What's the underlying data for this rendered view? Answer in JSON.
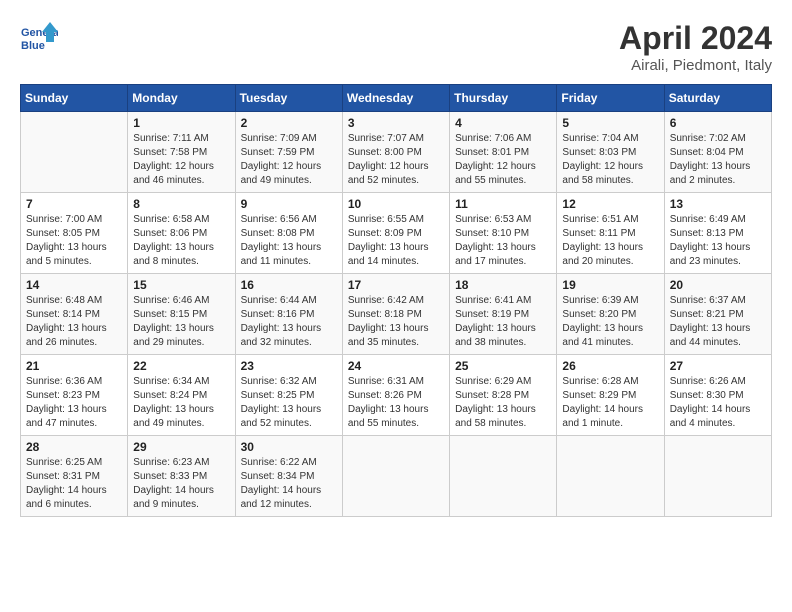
{
  "header": {
    "logo_line1": "General",
    "logo_line2": "Blue",
    "title": "April 2024",
    "subtitle": "Airali, Piedmont, Italy"
  },
  "weekdays": [
    "Sunday",
    "Monday",
    "Tuesday",
    "Wednesday",
    "Thursday",
    "Friday",
    "Saturday"
  ],
  "weeks": [
    [
      {
        "day": "",
        "sunrise": "",
        "sunset": "",
        "daylight": ""
      },
      {
        "day": "1",
        "sunrise": "Sunrise: 7:11 AM",
        "sunset": "Sunset: 7:58 PM",
        "daylight": "Daylight: 12 hours and 46 minutes."
      },
      {
        "day": "2",
        "sunrise": "Sunrise: 7:09 AM",
        "sunset": "Sunset: 7:59 PM",
        "daylight": "Daylight: 12 hours and 49 minutes."
      },
      {
        "day": "3",
        "sunrise": "Sunrise: 7:07 AM",
        "sunset": "Sunset: 8:00 PM",
        "daylight": "Daylight: 12 hours and 52 minutes."
      },
      {
        "day": "4",
        "sunrise": "Sunrise: 7:06 AM",
        "sunset": "Sunset: 8:01 PM",
        "daylight": "Daylight: 12 hours and 55 minutes."
      },
      {
        "day": "5",
        "sunrise": "Sunrise: 7:04 AM",
        "sunset": "Sunset: 8:03 PM",
        "daylight": "Daylight: 12 hours and 58 minutes."
      },
      {
        "day": "6",
        "sunrise": "Sunrise: 7:02 AM",
        "sunset": "Sunset: 8:04 PM",
        "daylight": "Daylight: 13 hours and 2 minutes."
      }
    ],
    [
      {
        "day": "7",
        "sunrise": "Sunrise: 7:00 AM",
        "sunset": "Sunset: 8:05 PM",
        "daylight": "Daylight: 13 hours and 5 minutes."
      },
      {
        "day": "8",
        "sunrise": "Sunrise: 6:58 AM",
        "sunset": "Sunset: 8:06 PM",
        "daylight": "Daylight: 13 hours and 8 minutes."
      },
      {
        "day": "9",
        "sunrise": "Sunrise: 6:56 AM",
        "sunset": "Sunset: 8:08 PM",
        "daylight": "Daylight: 13 hours and 11 minutes."
      },
      {
        "day": "10",
        "sunrise": "Sunrise: 6:55 AM",
        "sunset": "Sunset: 8:09 PM",
        "daylight": "Daylight: 13 hours and 14 minutes."
      },
      {
        "day": "11",
        "sunrise": "Sunrise: 6:53 AM",
        "sunset": "Sunset: 8:10 PM",
        "daylight": "Daylight: 13 hours and 17 minutes."
      },
      {
        "day": "12",
        "sunrise": "Sunrise: 6:51 AM",
        "sunset": "Sunset: 8:11 PM",
        "daylight": "Daylight: 13 hours and 20 minutes."
      },
      {
        "day": "13",
        "sunrise": "Sunrise: 6:49 AM",
        "sunset": "Sunset: 8:13 PM",
        "daylight": "Daylight: 13 hours and 23 minutes."
      }
    ],
    [
      {
        "day": "14",
        "sunrise": "Sunrise: 6:48 AM",
        "sunset": "Sunset: 8:14 PM",
        "daylight": "Daylight: 13 hours and 26 minutes."
      },
      {
        "day": "15",
        "sunrise": "Sunrise: 6:46 AM",
        "sunset": "Sunset: 8:15 PM",
        "daylight": "Daylight: 13 hours and 29 minutes."
      },
      {
        "day": "16",
        "sunrise": "Sunrise: 6:44 AM",
        "sunset": "Sunset: 8:16 PM",
        "daylight": "Daylight: 13 hours and 32 minutes."
      },
      {
        "day": "17",
        "sunrise": "Sunrise: 6:42 AM",
        "sunset": "Sunset: 8:18 PM",
        "daylight": "Daylight: 13 hours and 35 minutes."
      },
      {
        "day": "18",
        "sunrise": "Sunrise: 6:41 AM",
        "sunset": "Sunset: 8:19 PM",
        "daylight": "Daylight: 13 hours and 38 minutes."
      },
      {
        "day": "19",
        "sunrise": "Sunrise: 6:39 AM",
        "sunset": "Sunset: 8:20 PM",
        "daylight": "Daylight: 13 hours and 41 minutes."
      },
      {
        "day": "20",
        "sunrise": "Sunrise: 6:37 AM",
        "sunset": "Sunset: 8:21 PM",
        "daylight": "Daylight: 13 hours and 44 minutes."
      }
    ],
    [
      {
        "day": "21",
        "sunrise": "Sunrise: 6:36 AM",
        "sunset": "Sunset: 8:23 PM",
        "daylight": "Daylight: 13 hours and 47 minutes."
      },
      {
        "day": "22",
        "sunrise": "Sunrise: 6:34 AM",
        "sunset": "Sunset: 8:24 PM",
        "daylight": "Daylight: 13 hours and 49 minutes."
      },
      {
        "day": "23",
        "sunrise": "Sunrise: 6:32 AM",
        "sunset": "Sunset: 8:25 PM",
        "daylight": "Daylight: 13 hours and 52 minutes."
      },
      {
        "day": "24",
        "sunrise": "Sunrise: 6:31 AM",
        "sunset": "Sunset: 8:26 PM",
        "daylight": "Daylight: 13 hours and 55 minutes."
      },
      {
        "day": "25",
        "sunrise": "Sunrise: 6:29 AM",
        "sunset": "Sunset: 8:28 PM",
        "daylight": "Daylight: 13 hours and 58 minutes."
      },
      {
        "day": "26",
        "sunrise": "Sunrise: 6:28 AM",
        "sunset": "Sunset: 8:29 PM",
        "daylight": "Daylight: 14 hours and 1 minute."
      },
      {
        "day": "27",
        "sunrise": "Sunrise: 6:26 AM",
        "sunset": "Sunset: 8:30 PM",
        "daylight": "Daylight: 14 hours and 4 minutes."
      }
    ],
    [
      {
        "day": "28",
        "sunrise": "Sunrise: 6:25 AM",
        "sunset": "Sunset: 8:31 PM",
        "daylight": "Daylight: 14 hours and 6 minutes."
      },
      {
        "day": "29",
        "sunrise": "Sunrise: 6:23 AM",
        "sunset": "Sunset: 8:33 PM",
        "daylight": "Daylight: 14 hours and 9 minutes."
      },
      {
        "day": "30",
        "sunrise": "Sunrise: 6:22 AM",
        "sunset": "Sunset: 8:34 PM",
        "daylight": "Daylight: 14 hours and 12 minutes."
      },
      {
        "day": "",
        "sunrise": "",
        "sunset": "",
        "daylight": ""
      },
      {
        "day": "",
        "sunrise": "",
        "sunset": "",
        "daylight": ""
      },
      {
        "day": "",
        "sunrise": "",
        "sunset": "",
        "daylight": ""
      },
      {
        "day": "",
        "sunrise": "",
        "sunset": "",
        "daylight": ""
      }
    ]
  ]
}
